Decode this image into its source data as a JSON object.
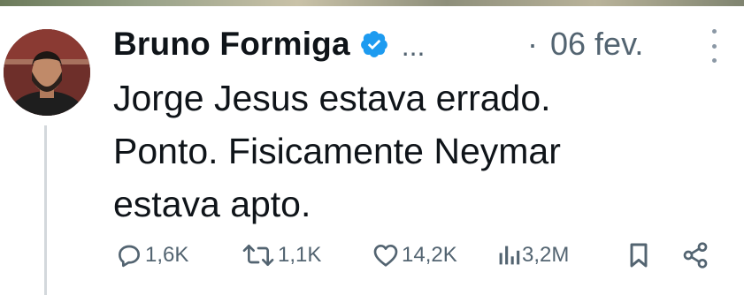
{
  "tweet": {
    "author": {
      "display_name": "Bruno Formiga",
      "verified": true,
      "ellipsis": "...",
      "separator": "·",
      "date": "06 fev."
    },
    "text_lines": [
      "Jorge Jesus estava errado.",
      "Ponto. Fisicamente Neymar",
      "estava apto."
    ],
    "actions": {
      "replies": "1,6K",
      "reposts": "1,1K",
      "likes": "14,2K",
      "views": "3,2M"
    },
    "icons": {
      "verified": "verified-badge-icon",
      "more": "more-vertical-icon",
      "reply": "reply-icon",
      "repost": "repost-icon",
      "like": "heart-icon",
      "views": "views-icon",
      "bookmark": "bookmark-icon",
      "share": "share-icon"
    },
    "colors": {
      "verified_blue": "#1d9bf0",
      "secondary_text": "#536471",
      "primary_text": "#0f1419"
    }
  }
}
